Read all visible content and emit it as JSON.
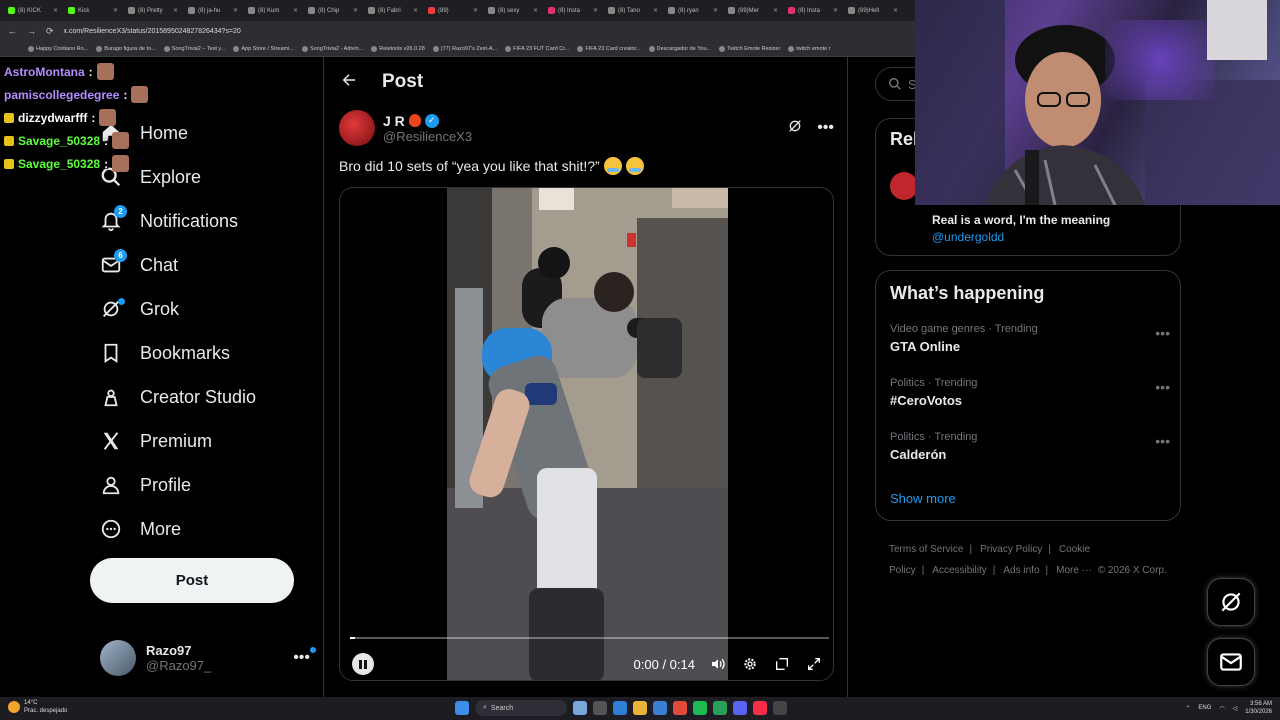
{
  "browser": {
    "tabs": [
      {
        "label": "(8) KICK",
        "color": "#53fc18"
      },
      {
        "label": "Kick",
        "color": "#53fc18"
      },
      {
        "label": "(8) Pretty",
        "color": "#888888"
      },
      {
        "label": "(8) ja-hu",
        "color": "#888888"
      },
      {
        "label": "(8) Kum",
        "color": "#888888"
      },
      {
        "label": "(8) Chip",
        "color": "#888888"
      },
      {
        "label": "(8) Fabri",
        "color": "#888888"
      },
      {
        "label": "(89)",
        "color": "#ee3b3b"
      },
      {
        "label": "(8) sexy",
        "color": "#888888"
      },
      {
        "label": "(8) Insta",
        "color": "#e1306c"
      },
      {
        "label": "(8) Tano",
        "color": "#888888"
      },
      {
        "label": "(8) ryan",
        "color": "#888888"
      },
      {
        "label": "(89)Mer",
        "color": "#888888"
      },
      {
        "label": "(8) Insta",
        "color": "#e1306c"
      },
      {
        "label": "(89)Hell",
        "color": "#888888"
      }
    ],
    "url": "x.com/ResilienceX3/status/2015895024827826434?s=20",
    "bookmarks": [
      "Happy Cristiano Ro...",
      "Burago figura de to...",
      "SongTrivia2 – Test y...",
      "App Store / Streami...",
      "SongTrivia2 - Adivin...",
      "Reletools v26.0.28",
      "(77) Razo97's Zest-A...",
      "FIFA 23 FUT Card Cr...",
      "FIFA 23 Card creator...",
      "Descargador de You...",
      "Twitch Emote Resizer",
      "twitch emote r"
    ]
  },
  "chat": [
    {
      "user": "AstroMontana",
      "color": "#b58cff",
      "sep": " :",
      "badge": false
    },
    {
      "user": "pamiscollegedegree",
      "color": "#b58cff",
      "sep": " :",
      "badge": false
    },
    {
      "user": "dizzydwarfff",
      "color": "#ffffff",
      "sep": " :",
      "badge": true
    },
    {
      "user": "Savage_50328",
      "color": "#5cff3a",
      "sep": " :",
      "badge": true
    },
    {
      "user": "Savage_50328",
      "color": "#5cff3a",
      "sep": " :",
      "badge": true
    }
  ],
  "nav": {
    "items": [
      {
        "label": "Home",
        "icon": "home-icon",
        "badge": ""
      },
      {
        "label": "Explore",
        "icon": "search-icon",
        "badge": ""
      },
      {
        "label": "Notifications",
        "icon": "bell-icon",
        "badge": "2"
      },
      {
        "label": "Chat",
        "icon": "mail-icon",
        "badge": "6"
      },
      {
        "label": "Grok",
        "icon": "grok-icon",
        "badge": "dot"
      },
      {
        "label": "Bookmarks",
        "icon": "bookmark-icon",
        "badge": ""
      },
      {
        "label": "Creator Studio",
        "icon": "creator-studio-icon",
        "badge": ""
      },
      {
        "label": "Premium",
        "icon": "x-logo-icon",
        "badge": ""
      },
      {
        "label": "Profile",
        "icon": "person-icon",
        "badge": ""
      },
      {
        "label": "More",
        "icon": "more-circle-icon",
        "badge": ""
      }
    ],
    "post_label": "Post"
  },
  "account": {
    "name": "Razo97",
    "handle": "@Razo97_"
  },
  "post": {
    "header_title": "Post",
    "author_name": "J R",
    "author_handle": "@ResilienceX3",
    "text": "Bro did 10 sets of “yea you like that shit!?”",
    "video": {
      "time": "0:00 / 0:14",
      "progress": 0.01
    }
  },
  "right": {
    "search_placeholder": "Se",
    "relevant_title": "Rel",
    "relevant_bio": "Real is a word, I'm the meaning",
    "relevant_mention": "@undergoldd",
    "happening_title": "What’s happening",
    "trends": [
      {
        "meta": "Video game genres · Trending",
        "name": "GTA Online"
      },
      {
        "meta": "Politics · Trending",
        "name": "#CeroVotos"
      },
      {
        "meta": "Politics · Trending",
        "name": "Calderón"
      }
    ],
    "show_more": "Show more",
    "footer": [
      "Terms of Service",
      "Privacy Policy",
      "Cookie Policy",
      "Accessibility",
      "Ads info",
      "More ···",
      "© 2026 X Corp."
    ]
  },
  "taskbar": {
    "temp": "14°C",
    "weather": "Prac. despejado",
    "search": "Search",
    "lang": "ENG",
    "time": "3:56 AM",
    "date": "1/30/2026"
  }
}
